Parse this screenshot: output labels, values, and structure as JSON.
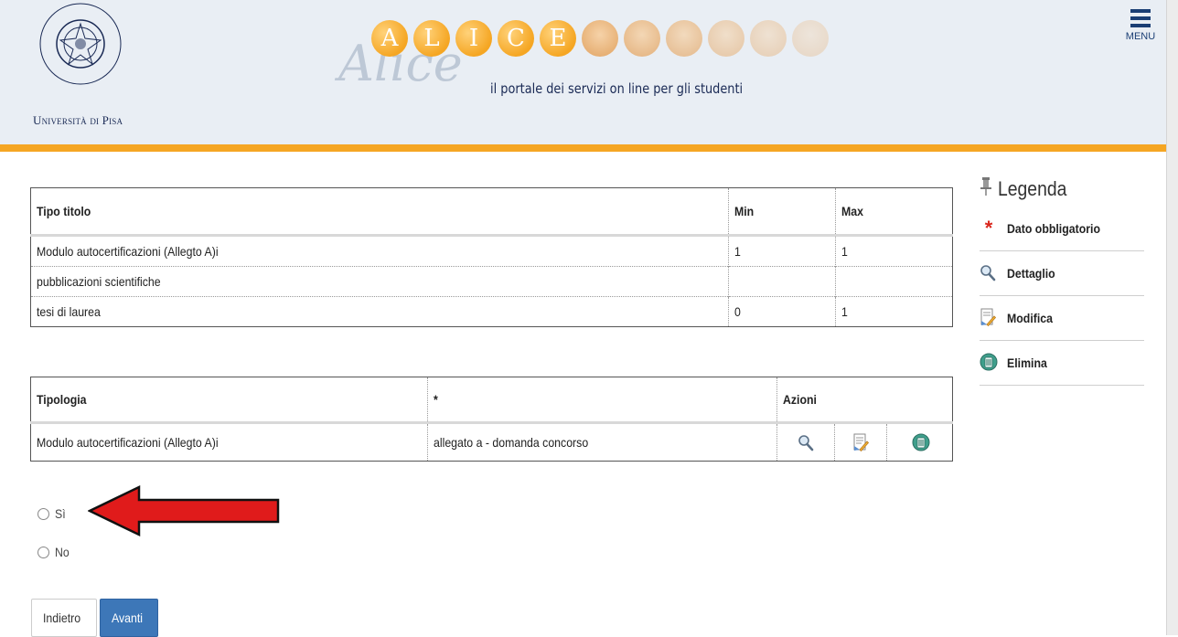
{
  "header": {
    "university_name": "Università di Pisa",
    "logo_text": "IN SUPREMAE DIGNITATIS",
    "logo_year": "1343",
    "banner_letters": [
      "A",
      "L",
      "I",
      "C",
      "E"
    ],
    "banner_script": "Alice",
    "tagline": "il portale dei servizi on line per gli studenti",
    "menu_label": "MENU"
  },
  "table1": {
    "headers": {
      "tipo": "Tipo titolo",
      "min": "Min",
      "max": "Max"
    },
    "rows": [
      {
        "tipo": "Modulo autocertificazioni (Allegto A)i",
        "min": "1",
        "max": "1"
      },
      {
        "tipo": "pubblicazioni scientifiche",
        "min": "",
        "max": ""
      },
      {
        "tipo": "tesi di laurea",
        "min": "0",
        "max": "1"
      }
    ]
  },
  "table2": {
    "headers": {
      "tipologia": "Tipologia",
      "star": "*",
      "azioni": "Azioni"
    },
    "rows": [
      {
        "tipologia": "Modulo autocertificazioni (Allegto A)i",
        "descr": "allegato a - domanda concorso"
      }
    ]
  },
  "legend": {
    "title": "Legenda",
    "items": [
      {
        "label": "Dato obbligatorio",
        "icon": "asterisk-icon"
      },
      {
        "label": "Dettaglio",
        "icon": "magnifier-icon"
      },
      {
        "label": "Modifica",
        "icon": "edit-icon"
      },
      {
        "label": "Elimina",
        "icon": "trash-icon"
      }
    ]
  },
  "radio": {
    "yes": "Sì",
    "no": "No"
  },
  "buttons": {
    "back": "Indietro",
    "next": "Avanti"
  },
  "colors": {
    "accent": "#f5a623",
    "primary_button": "#3d77b8",
    "arrow": "#e01b1b",
    "header_bg": "#e9eef4"
  }
}
